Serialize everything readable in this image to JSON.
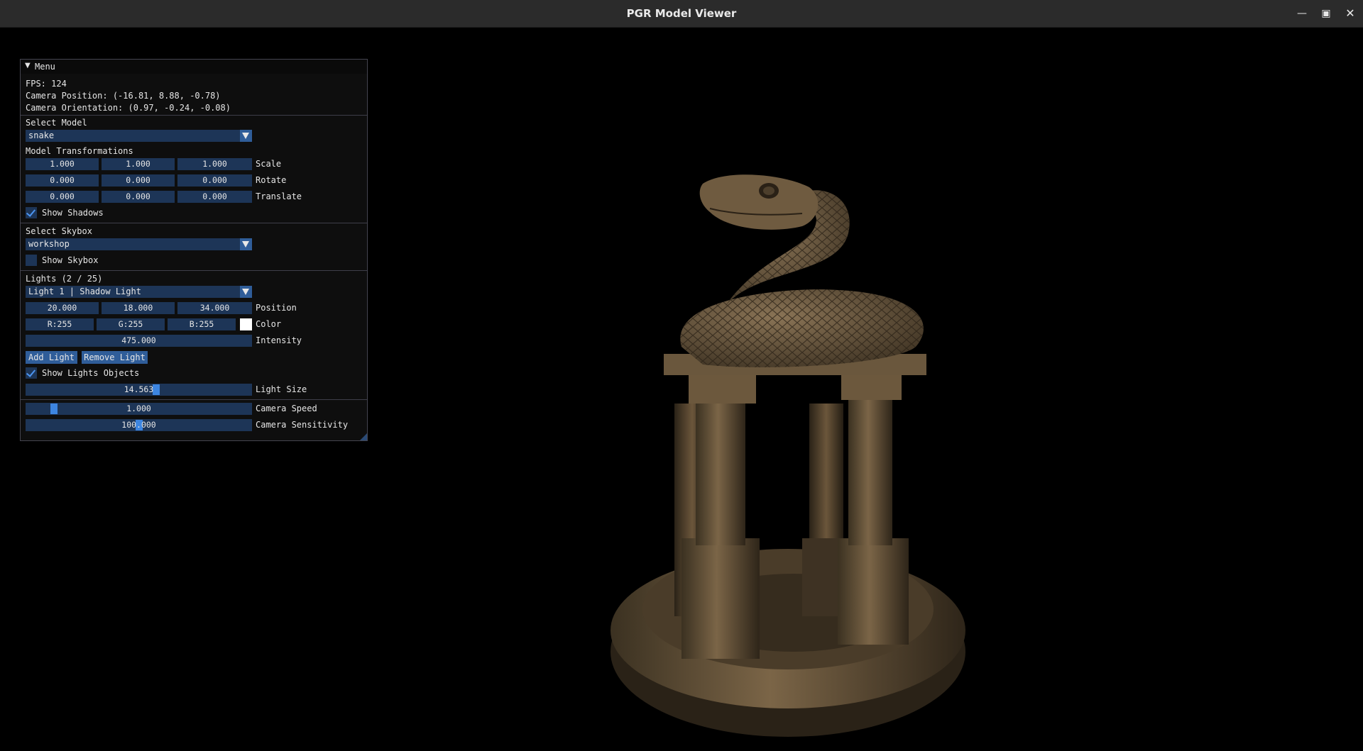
{
  "window": {
    "title": "PGR Model Viewer",
    "controls": {
      "minimize_icon": "minimize-icon",
      "maximize_icon": "maximize-icon",
      "close_icon": "close-icon"
    }
  },
  "menu": {
    "header": "Menu",
    "fps": "FPS: 124",
    "camera_position": "Camera Position: (-16.81, 8.88, -0.78)",
    "camera_orientation": "Camera Orientation: (0.97, -0.24, -0.08)",
    "select_model_label": "Select Model",
    "model_value": "snake",
    "transformations_label": "Model Transformations",
    "scale": {
      "x": "1.000",
      "y": "1.000",
      "z": "1.000",
      "label": "Scale"
    },
    "rotate": {
      "x": "0.000",
      "y": "0.000",
      "z": "0.000",
      "label": "Rotate"
    },
    "translate": {
      "x": "0.000",
      "y": "0.000",
      "z": "0.000",
      "label": "Translate"
    },
    "show_shadows": {
      "label": "Show Shadows",
      "checked": true
    },
    "select_skybox_label": "Select Skybox",
    "skybox_value": "workshop",
    "show_skybox": {
      "label": "Show Skybox",
      "checked": false
    },
    "lights_label": "Lights (2 / 25)",
    "light_value": "Light 1 | Shadow Light",
    "position": {
      "x": "20.000",
      "y": "18.000",
      "z": "34.000",
      "label": "Position"
    },
    "color": {
      "r": "R:255",
      "g": "G:255",
      "b": "B:255",
      "label": "Color",
      "swatch": "#ffffff"
    },
    "intensity": {
      "value": "475.000",
      "label": "Intensity"
    },
    "add_light": "Add Light",
    "remove_light": "Remove Light",
    "show_lights": {
      "label": "Show Lights Objects",
      "checked": true
    },
    "light_size": {
      "value": "14.563",
      "label": "Light Size",
      "level": 0.58
    },
    "camera_speed": {
      "value": "1.000",
      "label": "Camera Speed",
      "level": 0.11
    },
    "camera_sensitivity": {
      "value": "100.000",
      "label": "Camera Sensitivity",
      "level": 0.5
    }
  }
}
